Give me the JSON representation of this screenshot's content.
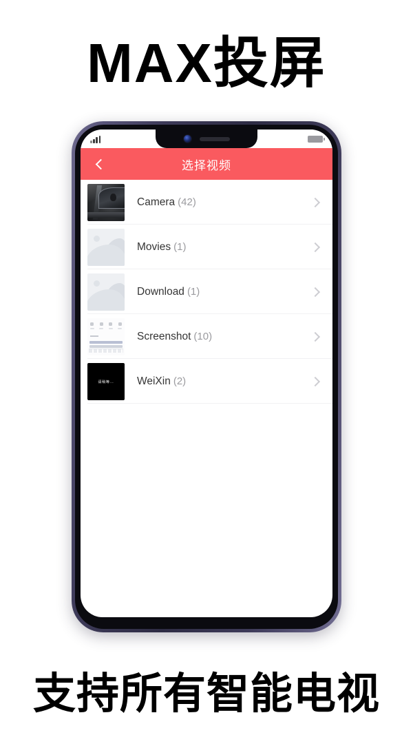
{
  "promo": {
    "headline_top": "MAX投屏",
    "headline_bottom": "支持所有智能电视"
  },
  "phone": {
    "status_bar": {
      "signal_icon": "signal-bars-icon",
      "battery_icon": "battery-icon"
    },
    "notch": {
      "camera_icon": "front-camera-icon",
      "speaker_icon": "earpiece-speaker-icon"
    }
  },
  "app": {
    "app_bar": {
      "back_icon": "chevron-left-icon",
      "title": "选择视频"
    },
    "folders": [
      {
        "name": "Camera",
        "count": "(42)",
        "thumb_kind": "photo-car",
        "chevron_icon": "chevron-right-icon"
      },
      {
        "name": "Movies",
        "count": "(1)",
        "thumb_kind": "image-placeholder",
        "chevron_icon": "chevron-right-icon"
      },
      {
        "name": "Download",
        "count": "(1)",
        "thumb_kind": "image-placeholder",
        "chevron_icon": "chevron-right-icon"
      },
      {
        "name": "Screenshot",
        "count": "(10)",
        "thumb_kind": "screenshot",
        "chevron_icon": "chevron-right-icon"
      },
      {
        "name": "WeiXin",
        "count": "(2)",
        "thumb_kind": "black-video",
        "thumb_text": "请稍等…",
        "chevron_icon": "chevron-right-icon"
      }
    ]
  },
  "colors": {
    "accent": "#fa5a5f",
    "title_text": "#ffffff",
    "row_label": "#353535",
    "row_count": "#9b9b9f",
    "chevron": "#cdcdd2",
    "page_background": "#ffffff",
    "headline": "#000000"
  }
}
